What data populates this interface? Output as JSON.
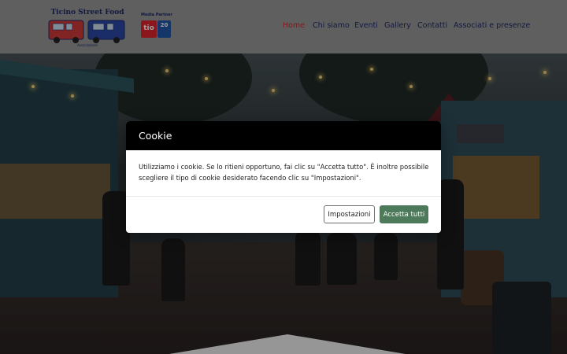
{
  "header": {
    "logo_alt": "Ticino Street Food Associazione",
    "logo_title": "Ticino Street Food",
    "logo_subtitle": "Associazione",
    "partner": {
      "label": "Media Partner",
      "tio": "tio",
      "twenty": "20"
    },
    "nav": [
      {
        "label": "Home",
        "active": true
      },
      {
        "label": "Chi siamo",
        "active": false
      },
      {
        "label": "Eventi",
        "active": false
      },
      {
        "label": "Gallery",
        "active": false
      },
      {
        "label": "Contatti",
        "active": false
      },
      {
        "label": "Associati e presenze",
        "active": false
      }
    ]
  },
  "colors": {
    "nav_active": "#c9272d",
    "nav_default": "#1d2a6b",
    "accept_button": "#4d7a5a",
    "modal_header": "#000000"
  },
  "cookie_modal": {
    "title": "Cookie",
    "body": "Utilizziamo i cookie. Se lo ritieni opportuno, fai clic su \"Accetta tutto\". È inoltre possibile scegliere il tipo di cookie desiderato facendo clic su \"Impostazioni\".",
    "settings_label": "Impostazioni",
    "accept_label": "Accetta tutti"
  }
}
